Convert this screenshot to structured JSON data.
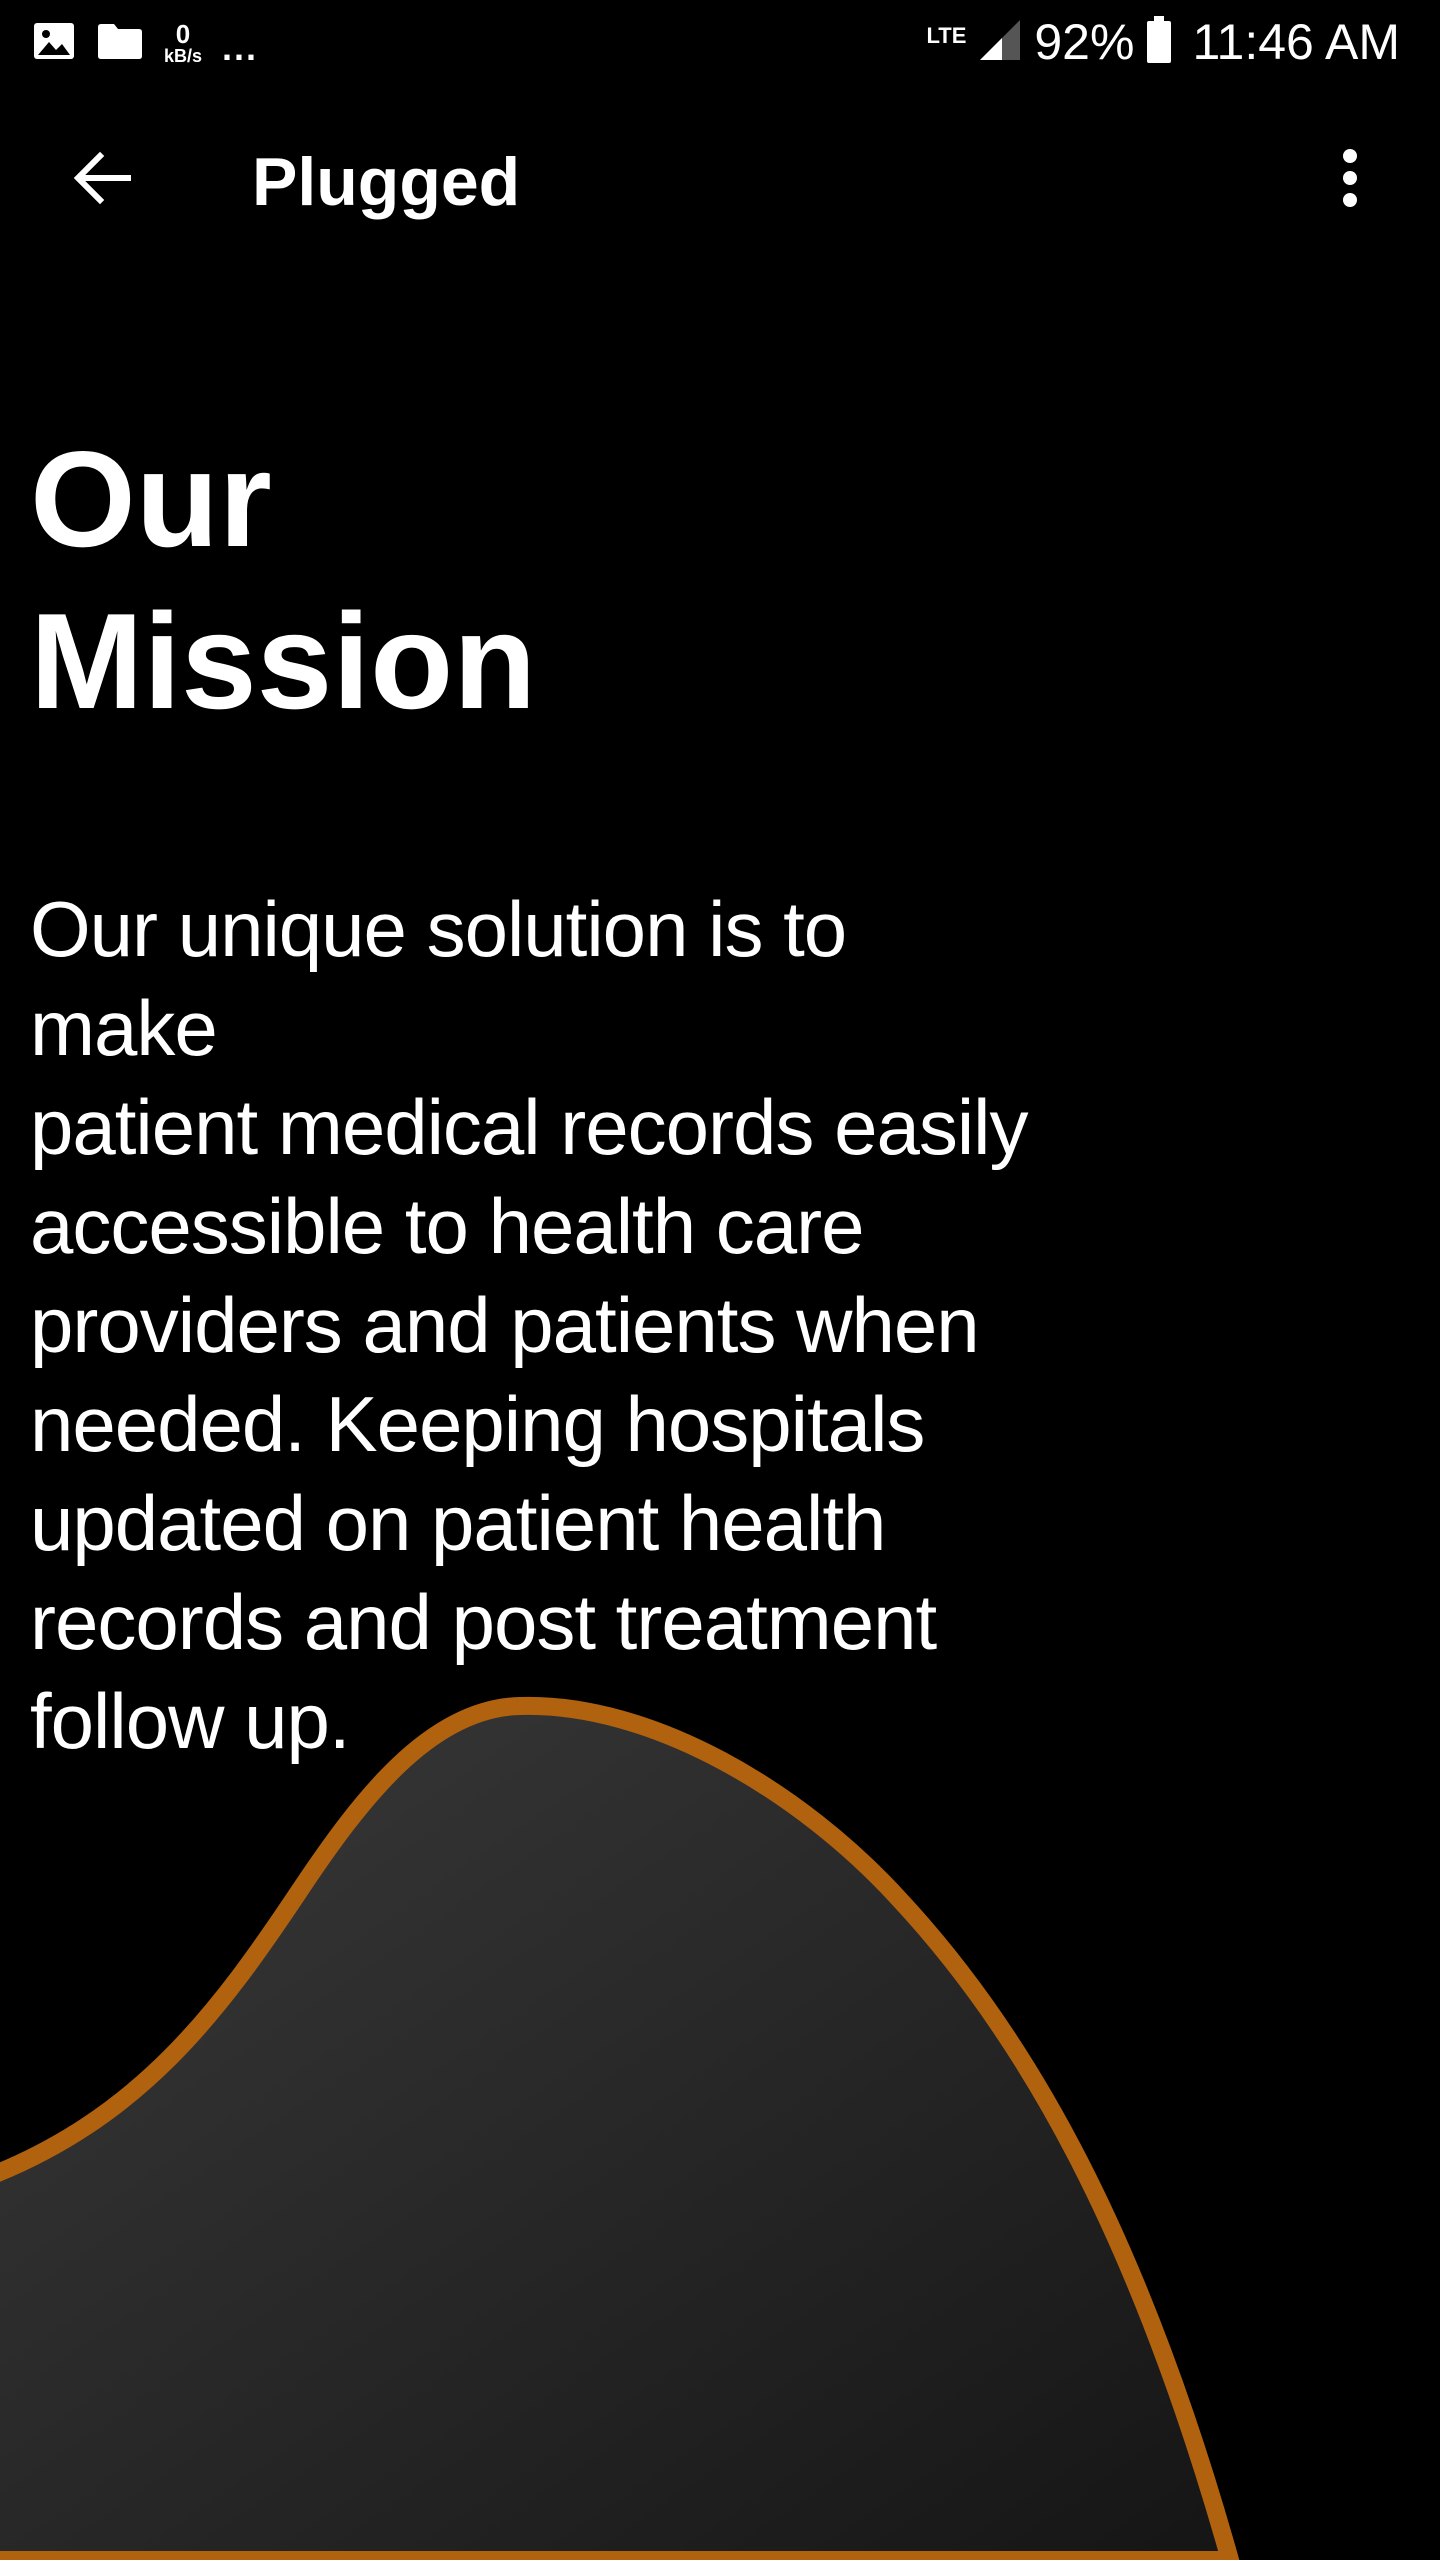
{
  "status_bar": {
    "net_speed_value": "0",
    "net_speed_unit": "kB/s",
    "overflow_dots": "...",
    "network_type": "LTE",
    "battery_percent": "92%",
    "time": "11:46 AM"
  },
  "app_bar": {
    "title": "Plugged"
  },
  "content": {
    "heading": "Our\nMission",
    "body": "Our unique solution is to make\npatient  medical records easily\naccessible to health  care\nproviders and patients when\nneeded.   Keeping hospitals\nupdated on patient  health\nrecords and post treatment\nfollow up."
  },
  "colors": {
    "background": "#000000",
    "accent_outline": "#b0620f",
    "blob_fill_light": "#3a3a3a",
    "blob_fill_dark": "#151515"
  },
  "icons": {
    "gallery": "image-icon",
    "folder": "folder-icon",
    "signal": "signal-icon",
    "battery": "battery-icon",
    "back": "arrow-back-icon",
    "menu": "more-vert-icon"
  }
}
